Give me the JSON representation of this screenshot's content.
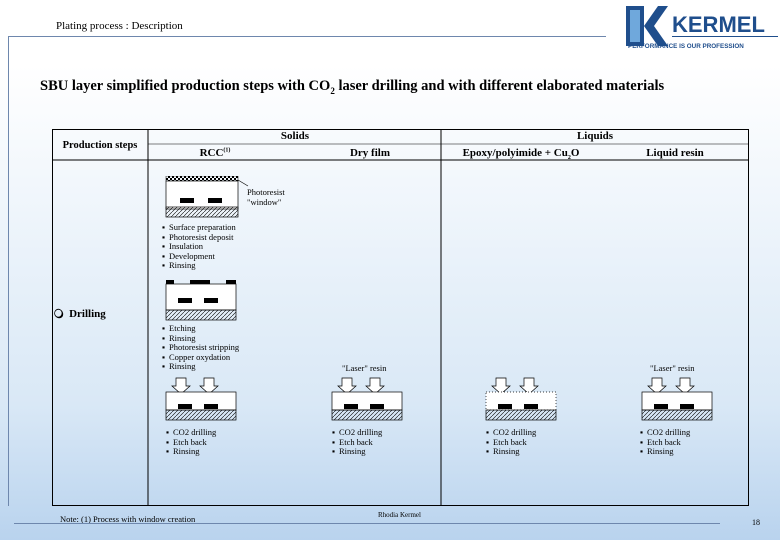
{
  "header": {
    "title": "Plating process : Description"
  },
  "logo": {
    "name": "KERMEL",
    "tagline": "PERFORMANCE IS OUR PROFESSION",
    "color": "#1f4e8c"
  },
  "main_title": {
    "prefix": "SBU layer simplified production steps with CO",
    "sub": "2",
    "suffix": " laser drilling and with different elaborated materials"
  },
  "table": {
    "production_steps": "Production steps",
    "solids": "Solids",
    "liquids": "Liquids",
    "col_rcc": "RCC",
    "col_rcc_sup": "(1)",
    "col_dry_film": "Dry film",
    "col_epoxy": "Epoxy/polyimide + Cu",
    "col_epoxy_sub": "2",
    "col_epoxy_o": "O",
    "col_liquid_resin": "Liquid resin",
    "drilling": "Drilling",
    "photoresist_line1": "Photoresist",
    "photoresist_line2": "\"window\"",
    "steps_prep": [
      "Surface preparation",
      "Photoresist deposit",
      "Insulation",
      "Development",
      "Rinsing"
    ],
    "steps_etch": [
      "Etching",
      "Rinsing",
      "Photoresist stripping",
      "Copper oxydation",
      "Rinsing"
    ],
    "laser_resin": "\"Laser\" resin",
    "drill_steps": [
      "CO2 drilling",
      "Etch back",
      "Rinsing"
    ]
  },
  "footer": {
    "note": "Note: (1) Process with window creation",
    "company": "Rhodia Kermel",
    "page": "18"
  }
}
